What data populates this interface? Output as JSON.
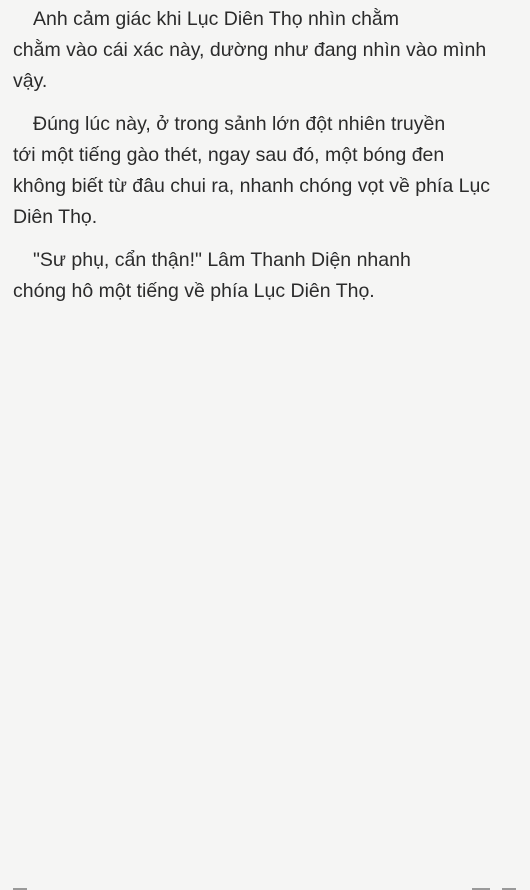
{
  "paragraphs": [
    {
      "lines": [
        "Anh cảm giác khi Lục Diên Thọ nhìn chằm",
        "chằm vào cái xác này, dường như đang nhìn vào mình",
        "vậy."
      ]
    },
    {
      "lines": [
        "Đúng lúc này, ở trong sảnh lớn đột nhiên truyền",
        "tới một tiếng gào thét, ngay sau đó, một bóng đen",
        "không biết từ đâu chui ra, nhanh chóng vọt về phía Lục",
        "Diên Thọ."
      ]
    },
    {
      "lines": [
        "\"Sư phụ, cẩn thận!\" Lâm Thanh Diện nhanh",
        "chóng hô một tiếng về phía Lục Diên Thọ."
      ]
    }
  ]
}
